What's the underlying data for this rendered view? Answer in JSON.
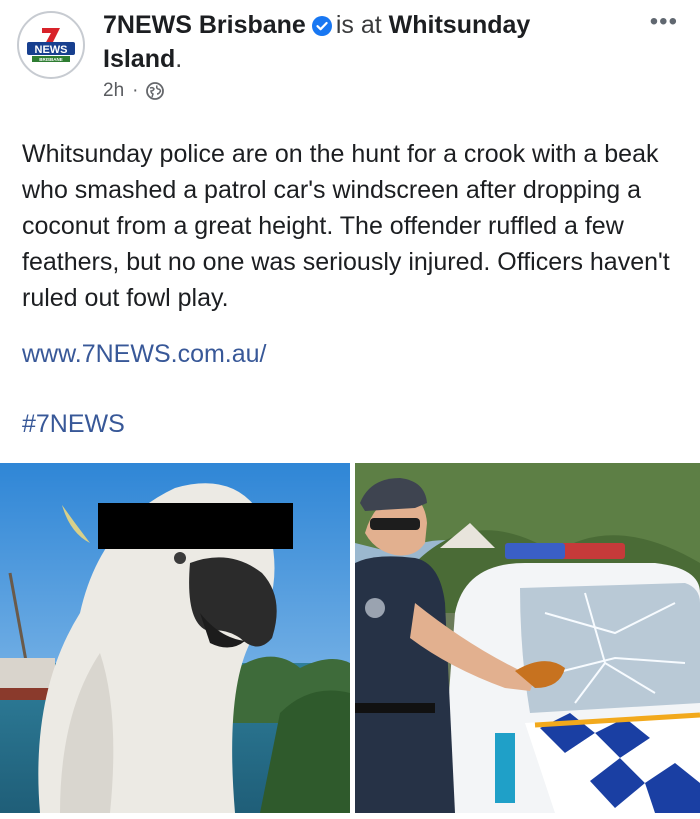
{
  "post": {
    "author": {
      "name": "7NEWS Brisbane",
      "verified": true,
      "avatar_text_top": "7",
      "avatar_text_main": "NEWS",
      "avatar_text_sub": "BRISBANE"
    },
    "location_prefix": "is at",
    "location": "Whitsunday Island",
    "location_suffix": ".",
    "timestamp": "2h",
    "separator": "·",
    "privacy_icon": "globe-icon",
    "more_icon": "more-options-icon",
    "text": "Whitsunday police are on the hunt for a crook with a beak who smashed a patrol car's windscreen after dropping a coconut from a great height. The offender ruffled a few feathers, but no one was seriously injured. Officers haven't ruled out fowl play.",
    "link": "www.7NEWS.com.au/",
    "hashtag": "#7NEWS"
  },
  "photos": [
    {
      "subject": "cockatoo-photo"
    },
    {
      "subject": "police-officer-with-damaged-car-photo"
    }
  ],
  "colors": {
    "link": "#385898",
    "verified": "#1877f2",
    "brand_red": "#d8232a",
    "brand_blue": "#173f8f"
  }
}
